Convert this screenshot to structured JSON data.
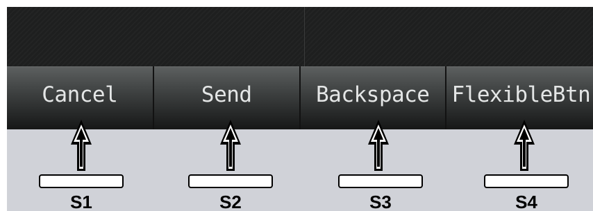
{
  "softkeys": [
    {
      "label": "Cancel"
    },
    {
      "label": "Send"
    },
    {
      "label": "Backspace"
    },
    {
      "label": "FlexibleBtn"
    }
  ],
  "hardware_keys": [
    {
      "label": "S1"
    },
    {
      "label": "S2"
    },
    {
      "label": "S3"
    },
    {
      "label": "S4"
    }
  ],
  "colors": {
    "screen_background": "#1e1f1f",
    "softkey_text": "#e4e6e6",
    "bezel": "#d0d2d8",
    "arrow": "#000000"
  }
}
